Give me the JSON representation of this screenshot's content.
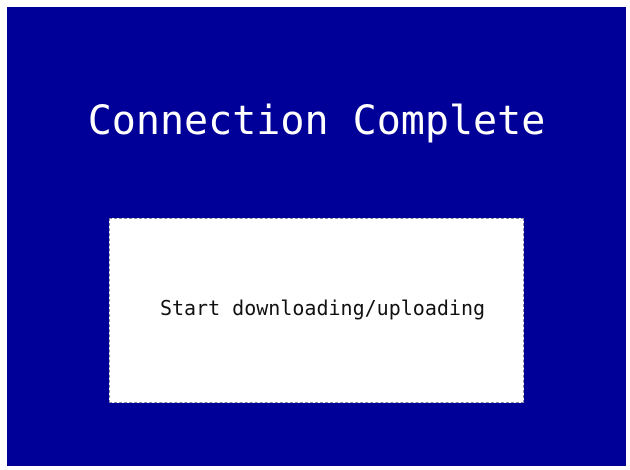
{
  "screen": {
    "title": "Connection Complete",
    "background_color": "#000099"
  },
  "action": {
    "label": "Start downloading/uploading"
  }
}
